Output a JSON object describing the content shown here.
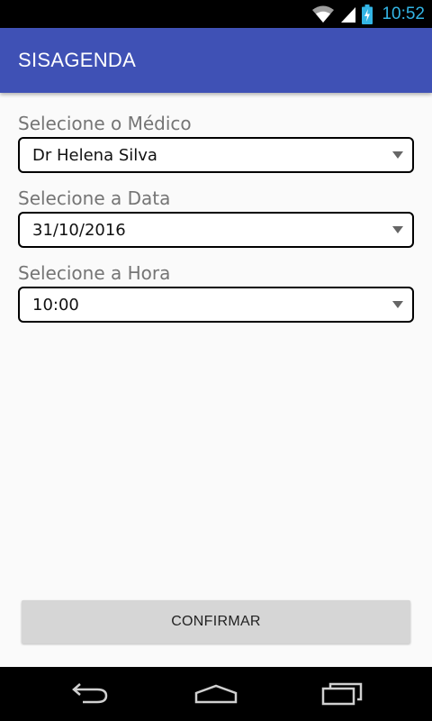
{
  "status_bar": {
    "time": "10:52",
    "icons": [
      "wifi-icon",
      "signal-icon",
      "battery-charging-icon"
    ],
    "clock_color": "#33b5e5"
  },
  "app_bar": {
    "title": "SISAGENDA",
    "color": "#3f51b5"
  },
  "form": {
    "doctor": {
      "label": "Selecione o Médico",
      "value": "Dr Helena Silva"
    },
    "date": {
      "label": "Selecione a Data",
      "value": "31/10/2016"
    },
    "time": {
      "label": "Selecione a Hora",
      "value": "10:00"
    }
  },
  "confirm_button": {
    "label": "CONFIRMAR"
  },
  "nav_bar": {
    "icons": [
      "back-icon",
      "home-icon",
      "recents-icon"
    ]
  }
}
